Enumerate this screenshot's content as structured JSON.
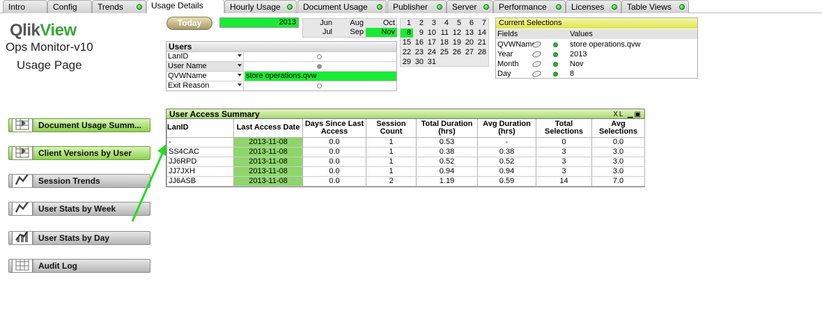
{
  "tabs": [
    {
      "label": "Intro",
      "dot": false
    },
    {
      "label": "Config",
      "dot": false
    },
    {
      "label": "Trends",
      "dot": true
    },
    {
      "label": "Usage Details",
      "dot": false,
      "active": true
    },
    {
      "label": "Hourly Usage",
      "dot": true
    },
    {
      "label": "Document Usage",
      "dot": true
    },
    {
      "label": "Publisher",
      "dot": true
    },
    {
      "label": "Server",
      "dot": true
    },
    {
      "label": "Performance",
      "dot": true
    },
    {
      "label": "Licenses",
      "dot": true
    },
    {
      "label": "Table Views",
      "dot": true
    }
  ],
  "brand": {
    "logo_a": "Qlik",
    "logo_b": "View",
    "app_name": "Ops Monitor-v10",
    "page_name": "Usage Page"
  },
  "nav_buttons": [
    {
      "label": "Document  Usage  Summ...",
      "icon": "document-usage-icon"
    },
    {
      "label": "Client Versions by User",
      "icon": "client-versions-icon"
    },
    {
      "label": "Session Trends",
      "icon": "trend-line-icon"
    },
    {
      "label": "User Stats by Week",
      "icon": "trend-line-icon"
    },
    {
      "label": "User Stats by Day",
      "icon": "bar-trend-icon"
    },
    {
      "label": "Audit Log",
      "icon": "grid-icon"
    }
  ],
  "today_label": "Today",
  "year_value": "2013",
  "months": [
    "Jun",
    "Aug",
    "Oct",
    "Jul",
    "Sep",
    "Nov"
  ],
  "selected_month": "Nov",
  "users_box": {
    "title": "Users",
    "fields": [
      {
        "label": "LanID",
        "value": ""
      },
      {
        "label": "User Name",
        "value": ""
      },
      {
        "label": "QVWName",
        "value": "store operations.qvw"
      },
      {
        "label": "Exit Reason",
        "value": ""
      }
    ]
  },
  "calendar": {
    "days": [
      "1",
      "2",
      "3",
      "4",
      "5",
      "6",
      "7",
      "8",
      "9",
      "10",
      "11",
      "12",
      "13",
      "14",
      "15",
      "16",
      "17",
      "18",
      "19",
      "20",
      "21",
      "22",
      "23",
      "24",
      "25",
      "26",
      "27",
      "28",
      "29",
      "30",
      "31"
    ],
    "selected": "8"
  },
  "current_selections": {
    "title": "Current Selections",
    "col_fields": "Fields",
    "col_values": "Values",
    "rows": [
      {
        "field": "QVWName",
        "value": "store operations.qvw"
      },
      {
        "field": "Year",
        "value": "2013"
      },
      {
        "field": "Month",
        "value": "Nov"
      },
      {
        "field": "Day",
        "value": "8"
      }
    ]
  },
  "access_table": {
    "title": "User Access Summary",
    "controls": "XL",
    "columns": [
      "LanID",
      "Last Access Date",
      "Days Since Last Access",
      "Session Count",
      "Total Duration (hrs)",
      "Avg Duration (hrs)",
      "Total Selections",
      "Avg Selections"
    ],
    "rows": [
      [
        "-",
        "2013-11-08",
        "0.0",
        "1",
        "0.53",
        "-",
        "0",
        "0.0"
      ],
      [
        "SS4CAC",
        "2013-11-08",
        "0.0",
        "1",
        "0.38",
        "0.38",
        "3",
        "3.0"
      ],
      [
        "JJ6RPD",
        "2013-11-08",
        "0.0",
        "1",
        "0.52",
        "0.52",
        "3",
        "3.0"
      ],
      [
        "JJ7JXH",
        "2013-11-08",
        "0.0",
        "1",
        "0.94",
        "0.94",
        "3",
        "3.0"
      ],
      [
        "JJ6ASB",
        "2013-11-08",
        "0.0",
        "2",
        "1.19",
        "0.59",
        "14",
        "7.0"
      ]
    ]
  },
  "colors": {
    "selected_green": "#19ea35",
    "date_green": "#8ed66a",
    "arrow_green": "#22dd22"
  }
}
